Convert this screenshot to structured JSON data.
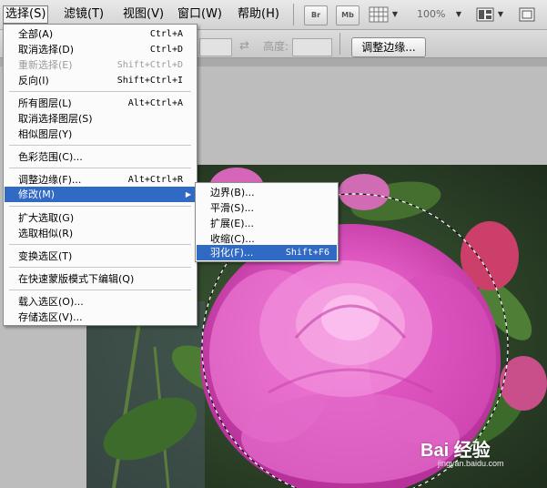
{
  "menubar": {
    "items": [
      {
        "label": "选择(S)"
      },
      {
        "label": "滤镜(T)"
      },
      {
        "label": "视图(V)"
      },
      {
        "label": "窗口(W)"
      },
      {
        "label": "帮助(H)"
      }
    ],
    "toolbar": {
      "bridge_label": "Br",
      "minibridge_label": "Mb",
      "zoom_value": "100%"
    }
  },
  "options_bar": {
    "height_label": "高度:",
    "refine_edge_button": "调整边缘..."
  },
  "select_menu": {
    "items": [
      {
        "label": "全部(A)",
        "shortcut": "Ctrl+A"
      },
      {
        "label": "取消选择(D)",
        "shortcut": "Ctrl+D"
      },
      {
        "label": "重新选择(E)",
        "shortcut": "Shift+Ctrl+D"
      },
      {
        "label": "反向(I)",
        "shortcut": "Shift+Ctrl+I"
      },
      {
        "label": "所有图层(L)",
        "shortcut": "Alt+Ctrl+A"
      },
      {
        "label": "取消选择图层(S)",
        "shortcut": ""
      },
      {
        "label": "相似图层(Y)",
        "shortcut": ""
      },
      {
        "label": "色彩范围(C)...",
        "shortcut": ""
      },
      {
        "label": "调整边缘(F)...",
        "shortcut": "Alt+Ctrl+R"
      },
      {
        "label": "修改(M)",
        "shortcut": ""
      },
      {
        "label": "扩大选取(G)",
        "shortcut": ""
      },
      {
        "label": "选取相似(R)",
        "shortcut": ""
      },
      {
        "label": "变换选区(T)",
        "shortcut": ""
      },
      {
        "label": "在快速蒙版模式下编辑(Q)",
        "shortcut": ""
      },
      {
        "label": "载入选区(O)...",
        "shortcut": ""
      },
      {
        "label": "存储选区(V)...",
        "shortcut": ""
      }
    ]
  },
  "modify_submenu": {
    "items": [
      {
        "label": "边界(B)...",
        "shortcut": ""
      },
      {
        "label": "平滑(S)...",
        "shortcut": ""
      },
      {
        "label": "扩展(E)...",
        "shortcut": ""
      },
      {
        "label": "收缩(C)...",
        "shortcut": ""
      },
      {
        "label": "羽化(F)...",
        "shortcut": "Shift+F6"
      }
    ]
  },
  "watermark": {
    "logo": "Bai 经验",
    "url": "jingyan.baidu.com"
  },
  "colors": {
    "highlight": "#316ac5",
    "menu_bg": "#fbfbfb",
    "disabled_text": "#9b9b9b",
    "rose_pink": "#e24fc0"
  }
}
